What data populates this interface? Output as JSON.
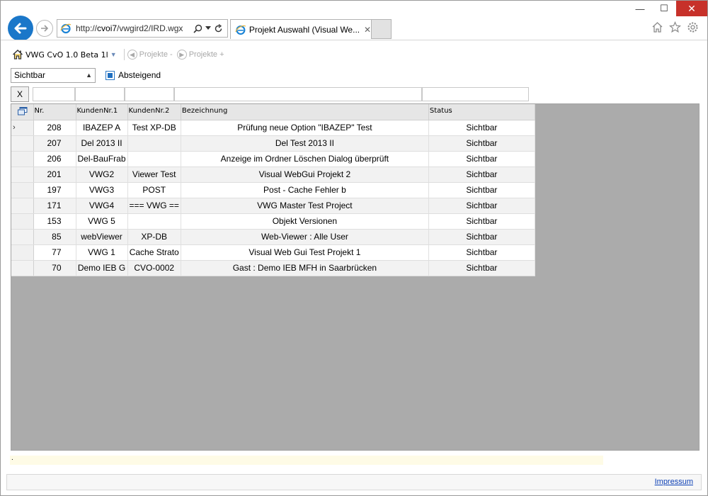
{
  "browser": {
    "url_prefix": "http://",
    "url_host": "cvoi7",
    "url_path": "/vwgird2/IRD.wgx",
    "tab_title": "Projekt Auswahl (Visual We...",
    "tab_close": "✕",
    "caption": {
      "minimize": "—",
      "maximize": "☐",
      "close": "✕"
    }
  },
  "app": {
    "title": "VWG CvO 1.0 Beta 1l",
    "prev_label": "Projekte -",
    "next_label": "Projekte +"
  },
  "filter": {
    "select_value": "Sichtbar",
    "checkbox_label": "Absteigend",
    "checkbox_checked": true,
    "clear_button": "X"
  },
  "grid": {
    "columns": [
      "Nr.",
      "KundenNr.1",
      "KundenNr.2",
      "Bezeichnung",
      "Status"
    ],
    "rows": [
      {
        "nr": "208",
        "k1": "IBAZEP A",
        "k2": "Test XP-DB",
        "bez": "Prüfung neue Option \"IBAZEP\" Test",
        "status": "Sichtbar",
        "marker": "›"
      },
      {
        "nr": "207",
        "k1": "Del 2013 II",
        "k2": "",
        "bez": "Del Test 2013 II",
        "status": "Sichtbar",
        "marker": ""
      },
      {
        "nr": "206",
        "k1": "Del-BauFrab",
        "k2": "",
        "bez": "Anzeige im Ordner Löschen Dialog überprüft",
        "status": "Sichtbar",
        "marker": ""
      },
      {
        "nr": "201",
        "k1": "VWG2",
        "k2": "Viewer Test",
        "bez": "Visual WebGui Projekt 2",
        "status": "Sichtbar",
        "marker": ""
      },
      {
        "nr": "197",
        "k1": "VWG3",
        "k2": "POST",
        "bez": "Post - Cache Fehler b",
        "status": "Sichtbar",
        "marker": ""
      },
      {
        "nr": "171",
        "k1": "VWG4",
        "k2": "=== VWG ==",
        "bez": "VWG Master Test Project",
        "status": "Sichtbar",
        "marker": ""
      },
      {
        "nr": "153",
        "k1": "VWG 5",
        "k2": "",
        "bez": "Objekt Versionen",
        "status": "Sichtbar",
        "marker": ""
      },
      {
        "nr": "85",
        "k1": "webViewer",
        "k2": "XP-DB",
        "bez": "Web-Viewer :  Alle User",
        "status": "Sichtbar",
        "marker": ""
      },
      {
        "nr": "77",
        "k1": "VWG 1",
        "k2": "Cache Strato",
        "bez": "Visual Web Gui Test Projekt 1",
        "status": "Sichtbar",
        "marker": ""
      },
      {
        "nr": "70",
        "k1": "Demo IEB G",
        "k2": "CVO-0002",
        "bez": "Gast : Demo IEB MFH in Saarbrücken",
        "status": "Sichtbar",
        "marker": ""
      }
    ]
  },
  "footer": {
    "note": ".",
    "impressum": "Impressum"
  },
  "colors": {
    "accent": "#1a77c9",
    "close": "#c7312a",
    "grid_bg": "#ababab",
    "link": "#0b3fb5"
  }
}
